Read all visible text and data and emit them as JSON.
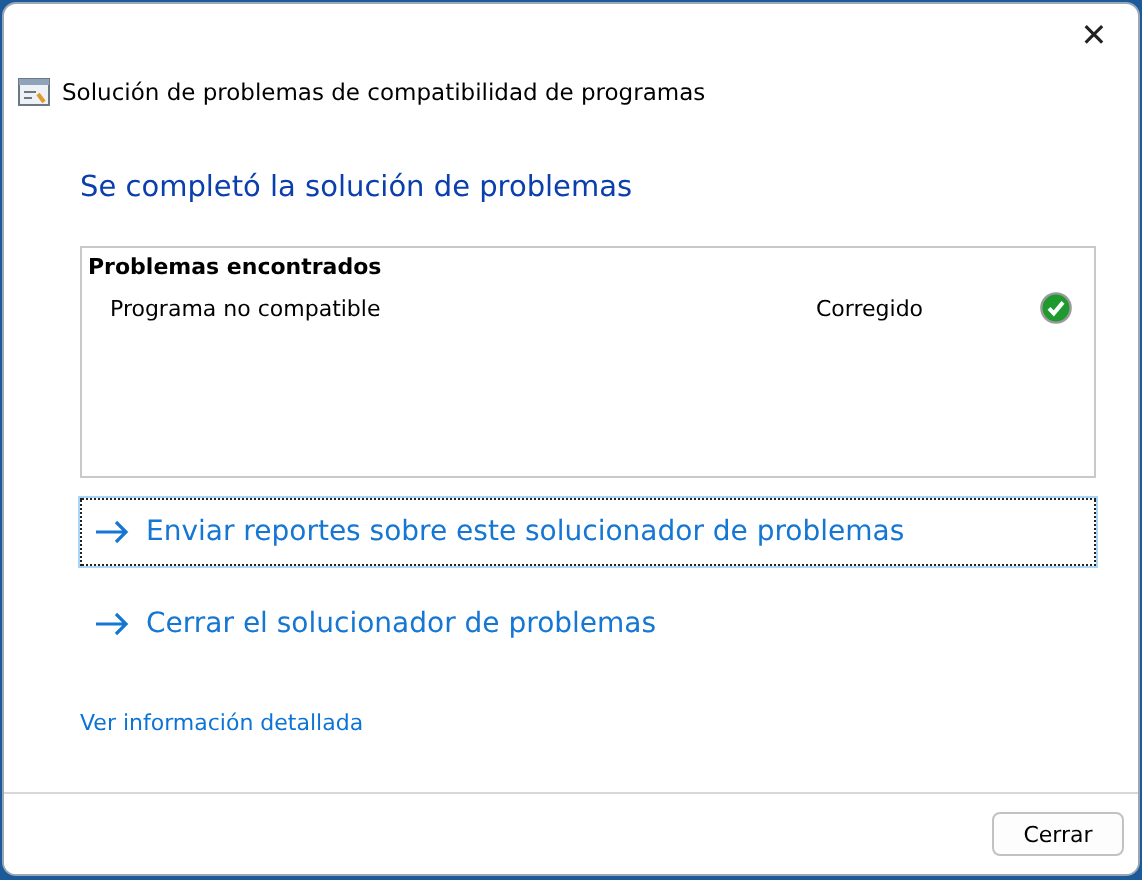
{
  "window": {
    "title": "Solución de problemas de compatibilidad de programas",
    "close": "✕"
  },
  "heading": "Se completó la solución de problemas",
  "problems": {
    "title": "Problemas encontrados",
    "rows": [
      {
        "name": "Programa no compatible",
        "status": "Corregido"
      }
    ]
  },
  "actions": [
    {
      "label": "Enviar reportes sobre este solucionador de problemas",
      "focused": true
    },
    {
      "label": "Cerrar el solucionador de problemas",
      "focused": false
    }
  ],
  "details_link": "Ver información detallada",
  "buttons": [
    "Cerrar"
  ]
}
